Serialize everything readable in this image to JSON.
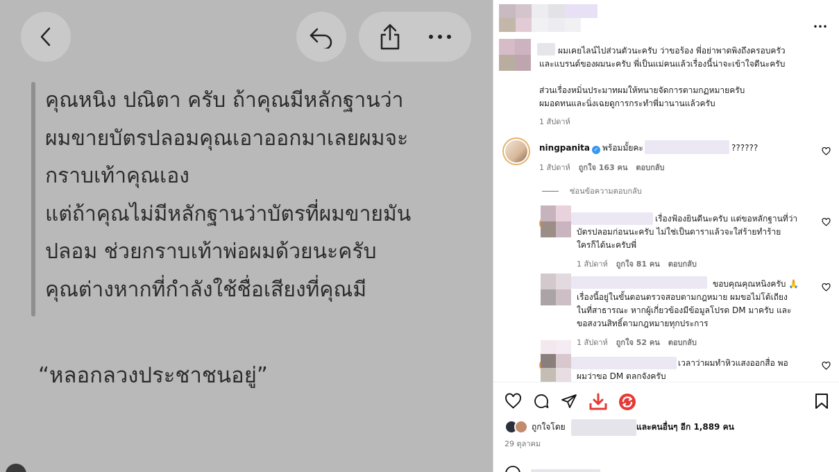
{
  "image_panel": {
    "quote_lines": [
      "คุณหนิง ปณิตา ครับ ถ้าคุณมีหลักฐานว่า",
      "ผมขายบัตรปลอมคุณเอาออกมาเลยผมจะ",
      "กราบเท้าคุณเอง",
      "แต่ถ้าคุณไม่มีหลักฐานว่าบัตรที่ผมขายมัน",
      "ปลอม ช่วยกราบเท้าพ่อผมด้วยนะครับ",
      "คุณต่างหากที่กำลังใช้ชื่อเสียงที่คุณมี"
    ],
    "claim": "“หลอกลวงประชาชนอยู่”"
  },
  "comments": {
    "top": {
      "lines": [
        "ผมเคยไลน์ไปส่วนตัวนะครับ ว่าขอร้อง พี่อย่าพาดพิงถึงครอบครัว",
        "และแบรนด์ของผมนะครับ พี่เป็นแม่คนแล้วเรื่องนี้น่าจะเข้าใจดีนะครับ",
        "",
        "ส่วนเรื่องหมิ่นประมาทผมให้ทนายจัดการตามกฏหมายครับ",
        "ผมอดทนและนิ่งเฉยดูการกระทำพี่มานานแล้วครับ"
      ],
      "time": "1 สัปดาห์"
    },
    "ning": {
      "username": "ningpanita",
      "text": "พร้อมมั้ยคะ",
      "suffix": "??????",
      "time": "1 สัปดาห์",
      "likes": "ถูกใจ 163 คน",
      "reply": "ตอบกลับ"
    },
    "hide_replies": "ซ่อนข้อความตอบกลับ",
    "replies": [
      {
        "lines": [
          "เรื่องฟ้องยินดีนะครับ แต่ขอหลักฐานที่ว่า",
          "บัตรปลอมก่อนนะครับ ไม่ใช่เป็นดาราแล้วจะใส่ร้ายทำร้าย",
          "ใครก็ได้นะครับพี่"
        ],
        "time": "1 สัปดาห์",
        "likes": "ถูกใจ 81 คน",
        "reply": "ตอบกลับ"
      },
      {
        "lines": [
          "ขอบคุณคุณหนิงครับ 🙏",
          "เรื่องนี้อยู่ในขั้นตอนตรวจสอบตามกฎหมาย ผมขอไม่โต้เถียง",
          "ในที่สาธารณะ หากผู้เกี่ยวข้องมีข้อมูลโปรด DM มาครับ และ",
          "ขอสงวนสิทธิ์ตามกฎหมายทุกประการ"
        ],
        "time": "1 สัปดาห์",
        "likes": "ถูกใจ 52 คน",
        "reply": "ตอบกลับ"
      },
      {
        "lines": [
          "เวลาว่าผมทำหิวแสงออกสื่อ พอ",
          "ผมว่าขอ DM ตลกจังครับ"
        ]
      }
    ]
  },
  "likes_row": {
    "prefix": "ถูกใจโดย",
    "suffix": "และคนอื่นๆ อีก 1,889 คน"
  },
  "post_date": "29 ตุลาคม",
  "colors": {
    "accent_red": "#e53935",
    "verified_blue": "#3897f0"
  }
}
